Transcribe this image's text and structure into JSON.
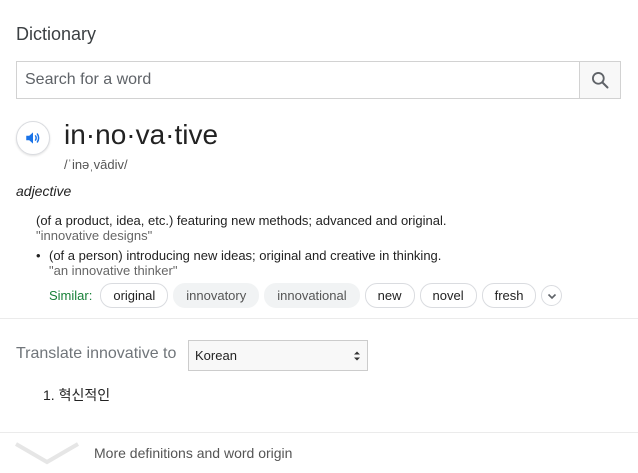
{
  "header": {
    "title": "Dictionary"
  },
  "search": {
    "placeholder": "Search for a word",
    "value": "",
    "icon": "search-icon"
  },
  "entry": {
    "word": "in·no·va·tive",
    "phonetic": "/ˈinəˌvādiv/",
    "part_of_speech": "adjective",
    "definitions": [
      {
        "text": "(of a product, idea, etc.) featuring new methods; advanced and original.",
        "example": "\"innovative designs\""
      },
      {
        "bullet": "•",
        "text": "(of a person) introducing new ideas; original and creative in thinking.",
        "example": "\"an innovative thinker\""
      }
    ],
    "similar_label": "Similar:",
    "similar": [
      "original",
      "innovatory",
      "innovational",
      "new",
      "novel",
      "fresh"
    ]
  },
  "translate": {
    "label": "Translate innovative to",
    "language": "Korean",
    "results": [
      "1. 혁신적인"
    ]
  },
  "footer": {
    "more_label": "More definitions and word origin"
  },
  "colors": {
    "accent": "#1a73e8",
    "similar_green": "#188038"
  }
}
